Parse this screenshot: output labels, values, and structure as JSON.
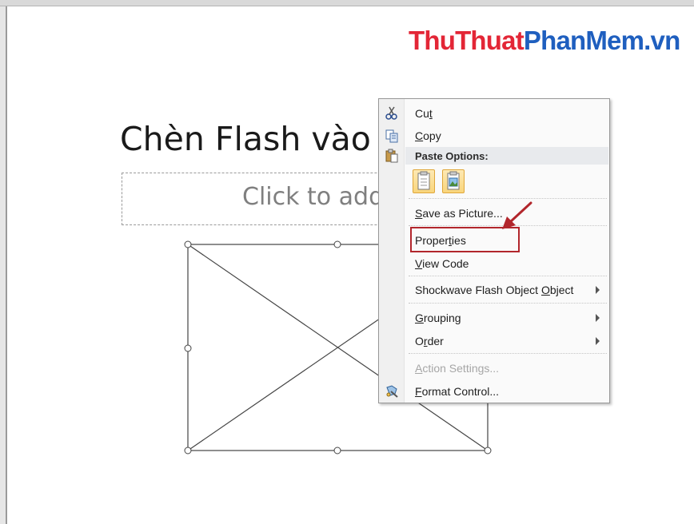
{
  "watermark": {
    "part1": "ThuThuat",
    "part2": "PhanMem.vn"
  },
  "slide": {
    "title": "Chèn Flash vào",
    "subtitle_placeholder": "Click to add"
  },
  "context_menu": {
    "cut": {
      "pre": "Cu",
      "key": "t",
      "post": ""
    },
    "copy": {
      "pre": "",
      "key": "C",
      "post": "opy"
    },
    "paste_options": "Paste Options:",
    "save_as_picture": {
      "pre": "",
      "key": "S",
      "post": "ave as Picture..."
    },
    "properties": {
      "pre": "Proper",
      "key": "t",
      "post": "ies"
    },
    "view_code": {
      "pre": "",
      "key": "V",
      "post": "iew Code"
    },
    "shockwave": {
      "pre": "Shockwave Flash Object ",
      "key": "O",
      "post": "bject"
    },
    "grouping": {
      "pre": "",
      "key": "G",
      "post": "rouping"
    },
    "order": {
      "pre": "O",
      "key": "r",
      "post": "der"
    },
    "action_settings": {
      "pre": "",
      "key": "A",
      "post": "ction Settings..."
    },
    "format_control": {
      "pre": "",
      "key": "F",
      "post": "ormat Control..."
    }
  },
  "colors": {
    "highlight_border": "#b2262c",
    "watermark_red": "#e32636",
    "watermark_blue": "#1f5fbf"
  }
}
